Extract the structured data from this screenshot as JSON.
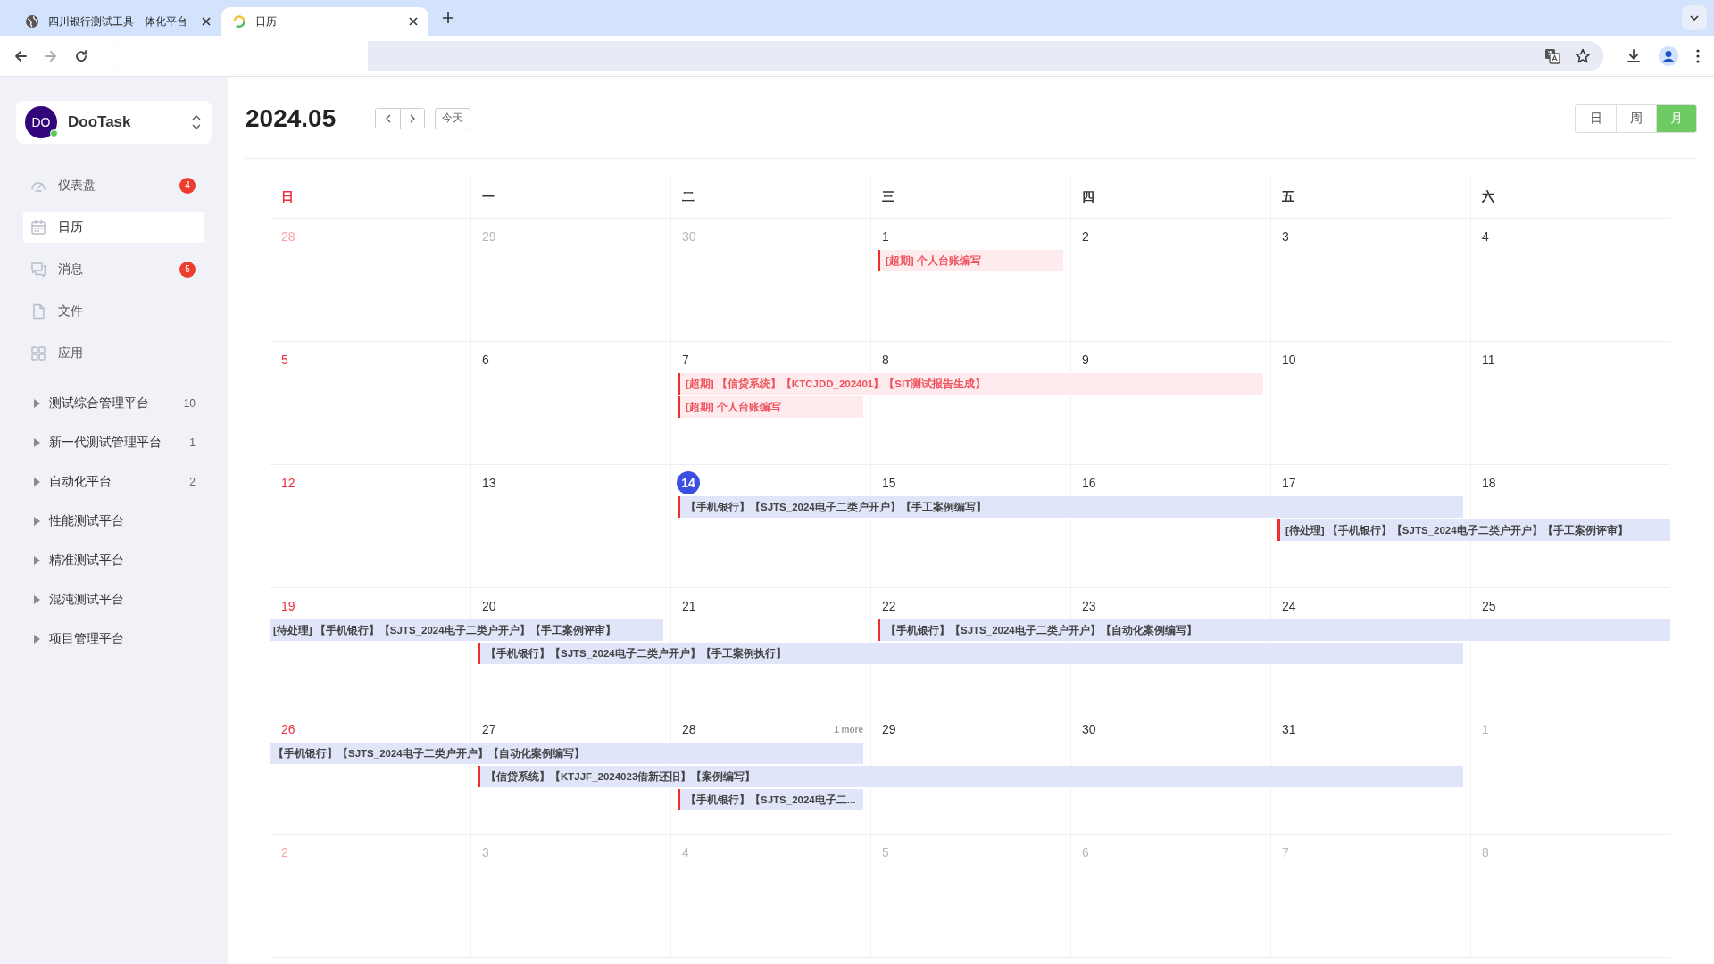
{
  "browser": {
    "tabs": [
      {
        "title": "四川银行测试工具一体化平台",
        "selected": false
      },
      {
        "title": "日历",
        "selected": true
      }
    ]
  },
  "sidebar": {
    "workspace": {
      "avatar": "DO",
      "name": "DooTask",
      "online": true
    },
    "nav": [
      {
        "label": "仪表盘",
        "badge": "4",
        "selected": false
      },
      {
        "label": "日历",
        "selected": true
      },
      {
        "label": "消息",
        "badge": "5",
        "selected": false
      },
      {
        "label": "文件",
        "selected": false
      },
      {
        "label": "应用",
        "selected": false
      }
    ],
    "projects": [
      {
        "name": "测试综合管理平台",
        "count": "10",
        "expanded": false
      },
      {
        "name": "新一代测试管理平台",
        "count": "1",
        "expanded": false
      },
      {
        "name": "自动化平台",
        "count": "2",
        "expanded": false
      },
      {
        "name": "性能测试平台",
        "expanded": false
      },
      {
        "name": "精准测试平台",
        "expanded": false
      },
      {
        "name": "混沌测试平台",
        "expanded": false
      },
      {
        "name": "项目管理平台",
        "expanded": false
      }
    ]
  },
  "calendar": {
    "title": "2024.05",
    "today_button": "今天",
    "views": [
      {
        "label": "日",
        "selected": false
      },
      {
        "label": "周",
        "selected": false
      },
      {
        "label": "月",
        "selected": true
      }
    ],
    "weekdays": [
      "日",
      "一",
      "二",
      "三",
      "四",
      "五",
      "六"
    ],
    "weeks": [
      {
        "days": [
          {
            "num": "28",
            "muted": true
          },
          {
            "num": "29",
            "muted": true
          },
          {
            "num": "30",
            "muted": true
          },
          {
            "num": "1",
            "muted": false
          },
          {
            "num": "2",
            "muted": false
          },
          {
            "num": "3",
            "muted": false
          },
          {
            "num": "4",
            "muted": false
          }
        ],
        "lanes": [
          [
            {
              "kind": "free"
            },
            {
              "kind": "free"
            },
            {
              "kind": "free"
            },
            {
              "kind": "event",
              "text": "[超期] 个人台账编写",
              "overdue": true,
              "continued": false
            },
            {
              "kind": "free"
            },
            {
              "kind": "free"
            },
            {
              "kind": "free"
            }
          ]
        ]
      },
      {
        "days": [
          {
            "num": "5",
            "muted": false
          },
          {
            "num": "6",
            "muted": false
          },
          {
            "num": "7",
            "muted": false
          },
          {
            "num": "8",
            "muted": false
          },
          {
            "num": "9",
            "muted": false
          },
          {
            "num": "10",
            "muted": false
          },
          {
            "num": "11",
            "muted": false
          }
        ],
        "lanes": [
          [
            {
              "kind": "free"
            },
            {
              "kind": "free"
            },
            {
              "kind": "event",
              "text": "[超期] 【信贷系统】【KTCJDD_202401】【SIT测试报告生成】",
              "overdue": true,
              "continued": false
            },
            {
              "kind": "span"
            },
            {
              "kind": "span"
            },
            {
              "kind": "free"
            },
            {
              "kind": "free"
            }
          ],
          [
            {
              "kind": "free"
            },
            {
              "kind": "free"
            },
            {
              "kind": "event",
              "text": "[超期] 个人台账编写",
              "overdue": true,
              "continued": false
            },
            {
              "kind": "free"
            },
            {
              "kind": "free"
            },
            {
              "kind": "free"
            },
            {
              "kind": "free"
            }
          ]
        ]
      },
      {
        "days": [
          {
            "num": "12",
            "muted": false
          },
          {
            "num": "13",
            "muted": false
          },
          {
            "num": "14",
            "muted": false,
            "today": true
          },
          {
            "num": "15",
            "muted": false
          },
          {
            "num": "16",
            "muted": false
          },
          {
            "num": "17",
            "muted": false
          },
          {
            "num": "18",
            "muted": false
          }
        ],
        "lanes": [
          [
            {
              "kind": "free"
            },
            {
              "kind": "free"
            },
            {
              "kind": "event",
              "text": "【手机银行】【SJTS_2024电子二类户开户】【手工案例编写】",
              "overdue": false,
              "continued": false
            },
            {
              "kind": "span"
            },
            {
              "kind": "span"
            },
            {
              "kind": "span"
            },
            {
              "kind": "free"
            }
          ],
          [
            {
              "kind": "free"
            },
            {
              "kind": "free"
            },
            {
              "kind": "free"
            },
            {
              "kind": "free"
            },
            {
              "kind": "free"
            },
            {
              "kind": "event",
              "text": "[待处理] 【手机银行】【SJTS_2024电子二类户开户】【手工案例评审】",
              "overdue": false,
              "continued": false
            },
            {
              "kind": "span"
            }
          ]
        ]
      },
      {
        "days": [
          {
            "num": "19",
            "muted": false
          },
          {
            "num": "20",
            "muted": false
          },
          {
            "num": "21",
            "muted": false
          },
          {
            "num": "22",
            "muted": false
          },
          {
            "num": "23",
            "muted": false
          },
          {
            "num": "24",
            "muted": false
          },
          {
            "num": "25",
            "muted": false
          }
        ],
        "lanes": [
          [
            {
              "kind": "event",
              "text": "[待处理] 【手机银行】【SJTS_2024电子二类户开户】【手工案例评审】",
              "overdue": false,
              "continued": true
            },
            {
              "kind": "span"
            },
            {
              "kind": "free"
            },
            {
              "kind": "event",
              "text": "【手机银行】【SJTS_2024电子二类户开户】【自动化案例编写】",
              "overdue": false,
              "continued": false
            },
            {
              "kind": "span"
            },
            {
              "kind": "span"
            },
            {
              "kind": "span"
            }
          ],
          [
            {
              "kind": "free"
            },
            {
              "kind": "event",
              "text": "【手机银行】【SJTS_2024电子二类户开户】【手工案例执行】",
              "overdue": false,
              "continued": false
            },
            {
              "kind": "span"
            },
            {
              "kind": "span"
            },
            {
              "kind": "span"
            },
            {
              "kind": "span"
            },
            {
              "kind": "free"
            }
          ]
        ]
      },
      {
        "days": [
          {
            "num": "26",
            "muted": false
          },
          {
            "num": "27",
            "muted": false
          },
          {
            "num": "28",
            "muted": false,
            "more": "1 more"
          },
          {
            "num": "29",
            "muted": false
          },
          {
            "num": "30",
            "muted": false
          },
          {
            "num": "31",
            "muted": false
          },
          {
            "num": "1",
            "muted": true
          }
        ],
        "lanes": [
          [
            {
              "kind": "event",
              "text": "【手机银行】【SJTS_2024电子二类户开户】【自动化案例编写】",
              "overdue": false,
              "continued": true
            },
            {
              "kind": "span"
            },
            {
              "kind": "span"
            },
            {
              "kind": "free"
            },
            {
              "kind": "free"
            },
            {
              "kind": "free"
            },
            {
              "kind": "free"
            }
          ],
          [
            {
              "kind": "free"
            },
            {
              "kind": "event",
              "text": "【信贷系统】【KTJJF_2024023借新还旧】【案例编写】",
              "overdue": false,
              "continued": false
            },
            {
              "kind": "span"
            },
            {
              "kind": "span"
            },
            {
              "kind": "span"
            },
            {
              "kind": "span"
            },
            {
              "kind": "free"
            }
          ],
          [
            {
              "kind": "free"
            },
            {
              "kind": "free"
            },
            {
              "kind": "event",
              "text": "【手机银行】【SJTS_2024电子二...",
              "overdue": false,
              "continued": false
            },
            {
              "kind": "free"
            },
            {
              "kind": "free"
            },
            {
              "kind": "free"
            },
            {
              "kind": "free"
            }
          ]
        ]
      },
      {
        "days": [
          {
            "num": "2",
            "muted": true
          },
          {
            "num": "3",
            "muted": true
          },
          {
            "num": "4",
            "muted": true
          },
          {
            "num": "5",
            "muted": true
          },
          {
            "num": "6",
            "muted": true
          },
          {
            "num": "7",
            "muted": true
          },
          {
            "num": "8",
            "muted": true
          }
        ]
      }
    ]
  }
}
